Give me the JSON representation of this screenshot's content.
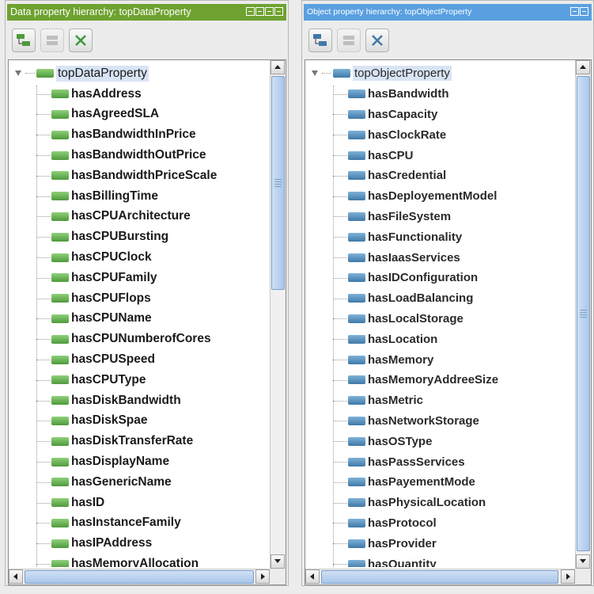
{
  "left_panel": {
    "title": "Data property hierarchy: topDataProperty",
    "root": "topDataProperty",
    "items": [
      "hasAddress",
      "hasAgreedSLA",
      "hasBandwidthInPrice",
      "hasBandwidthOutPrice",
      "hasBandwidthPriceScale",
      "hasBillingTime",
      "hasCPUArchitecture",
      "hasCPUBursting",
      "hasCPUClock",
      "hasCPUFamily",
      "hasCPUFlops",
      "hasCPUName",
      "hasCPUNumberofCores",
      "hasCPUSpeed",
      "hasCPUType",
      "hasDiskBandwidth",
      "hasDiskSpae",
      "hasDiskTransferRate",
      "hasDisplayName",
      "hasGenericName",
      "hasID",
      "hasInstanceFamily",
      "hasIPAddress",
      "hasMemoryAllocation"
    ]
  },
  "right_panel": {
    "title": "Object property hierarchy: topObjectProperty",
    "root": "topObjectProperty",
    "items": [
      "hasBandwidth",
      "hasCapacity",
      "hasClockRate",
      "hasCPU",
      "hasCredential",
      "hasDeployementModel",
      "hasFileSystem",
      "hasFunctionality",
      "hasIaasServices",
      "hasIDConfiguration",
      "hasLoadBalancing",
      "hasLocalStorage",
      "hasLocation",
      "hasMemory",
      "hasMemoryAddreeSize",
      "hasMetric",
      "hasNetworkStorage",
      "hasOSType",
      "hasPassServices",
      "hasPayementMode",
      "hasPhysicalLocation",
      "hasProtocol",
      "hasProvider",
      "hasQuantity"
    ]
  },
  "colors": {
    "data_title_bar": "#6ea230",
    "object_title_bar": "#5aa0e0",
    "data_property_icon": "#5fae48",
    "object_property_icon": "#4f88b8",
    "selection": "#d8e4f4"
  },
  "icons": {
    "toolbar_add_sub": "add-subproperty-icon",
    "toolbar_add_sibling": "add-sibling-property-icon",
    "toolbar_delete": "delete-property-icon"
  }
}
